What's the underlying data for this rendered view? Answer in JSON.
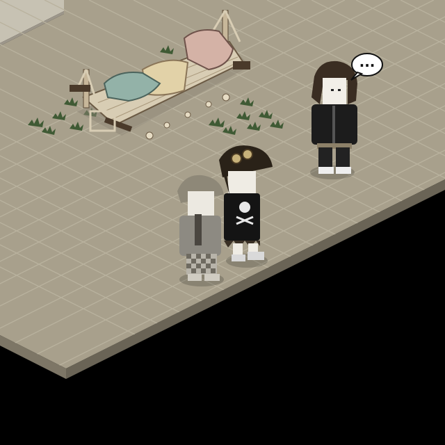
{
  "scene": {
    "title": "",
    "colors": {
      "background": "#000000",
      "floor_top": "#a8a08c",
      "floor_grid": "#b9b29e",
      "floor_edge_left": "#7d7666",
      "floor_edge_right": "#6a6456",
      "wall": "#c7c2b3",
      "wall_shadow": "#9c968a",
      "plant": "#3f5a34"
    }
  },
  "furniture": [
    {
      "name": "rope-hammock-bed",
      "pillows": [
        "teal-pillow",
        "pink-pillow"
      ],
      "blanket": "cream-blanket"
    }
  ],
  "avatars": [
    {
      "id": "avatar-leather-jacket",
      "outfit": "black-leather-jacket",
      "is_typing": true
    },
    {
      "id": "avatar-skull-shirt",
      "outfit": "black-skull-dress-goggle-hat",
      "is_typing": false
    },
    {
      "id": "avatar-grey-hoodie",
      "outfit": "grey-beanie-checkered-pants",
      "is_typing": false
    }
  ],
  "speech_bubble": {
    "text": "..."
  }
}
